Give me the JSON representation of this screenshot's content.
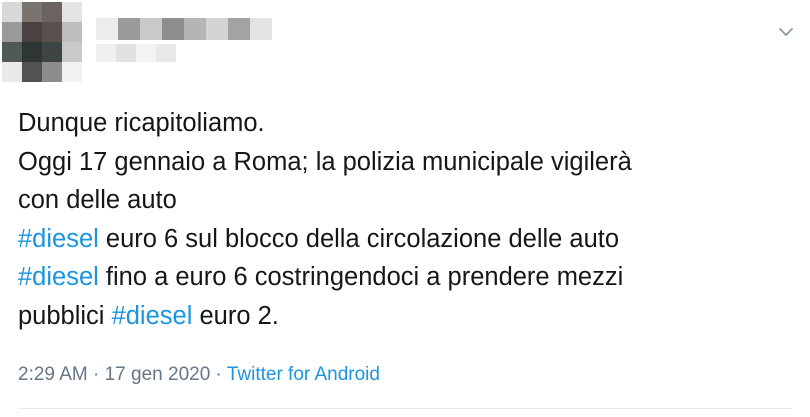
{
  "tweet": {
    "text_lines": [
      [
        {
          "text": "Dunque ricapitoliamo."
        }
      ],
      [
        {
          "text": "Oggi 17 gennaio a Roma; la polizia municipale vigilerà"
        }
      ],
      [
        {
          "text": "con delle auto"
        }
      ],
      [
        {
          "text": "#diesel",
          "hashtag": true
        },
        {
          "text": " euro 6 sul blocco della circolazione delle auto"
        }
      ],
      [
        {
          "text": "#diesel",
          "hashtag": true
        },
        {
          "text": " fino a euro 6 costringendoci a prendere mezzi"
        }
      ],
      [
        {
          "text": "pubblici "
        },
        {
          "text": "#diesel",
          "hashtag": true
        },
        {
          "text": " euro 2."
        }
      ]
    ],
    "time": "2:29 AM",
    "separator": " · ",
    "date": "17 gen 2020",
    "source": "Twitter for Android"
  },
  "icons": {
    "menu": "chevron-down-icon"
  },
  "colors": {
    "text": "#14171a",
    "hashtag": "#1b95e0",
    "meta": "#657786",
    "divider": "#e6ecf0"
  }
}
